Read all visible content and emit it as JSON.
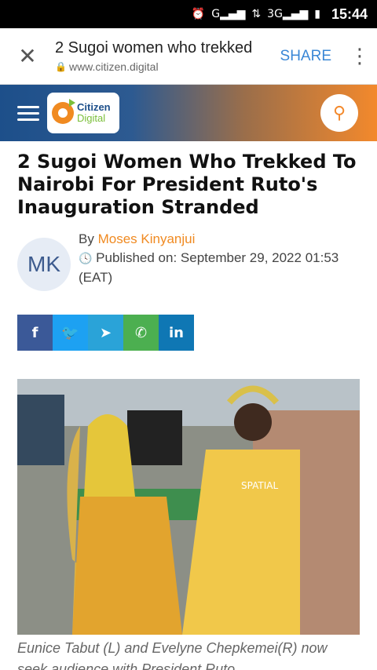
{
  "status": {
    "time": "15:44",
    "net1": "G",
    "net2": "3G"
  },
  "tab": {
    "title": "2 Sugoi women who trekked",
    "url": "www.citizen.digital",
    "share": "SHARE"
  },
  "site": {
    "logo_line1": "Citizen",
    "logo_line2": "Digital"
  },
  "article": {
    "headline": "2 Sugoi Women Who Trekked To Nairobi For President Ruto's Inauguration Stranded",
    "avatar": "MK",
    "by": "By",
    "author": "Moses Kinyanjui",
    "published": "Published on: September 29, 2022 01:53 (EAT)",
    "caption": "Eunice Tabut (L) and Evelyne Chepkemei(R) now seek audience with President Ruto"
  },
  "share_buttons": [
    "facebook-icon",
    "twitter-icon",
    "telegram-icon",
    "whatsapp-icon",
    "linkedin-icon"
  ],
  "colors": {
    "accent": "#f08a21",
    "brand_blue": "#1d4f8a"
  }
}
